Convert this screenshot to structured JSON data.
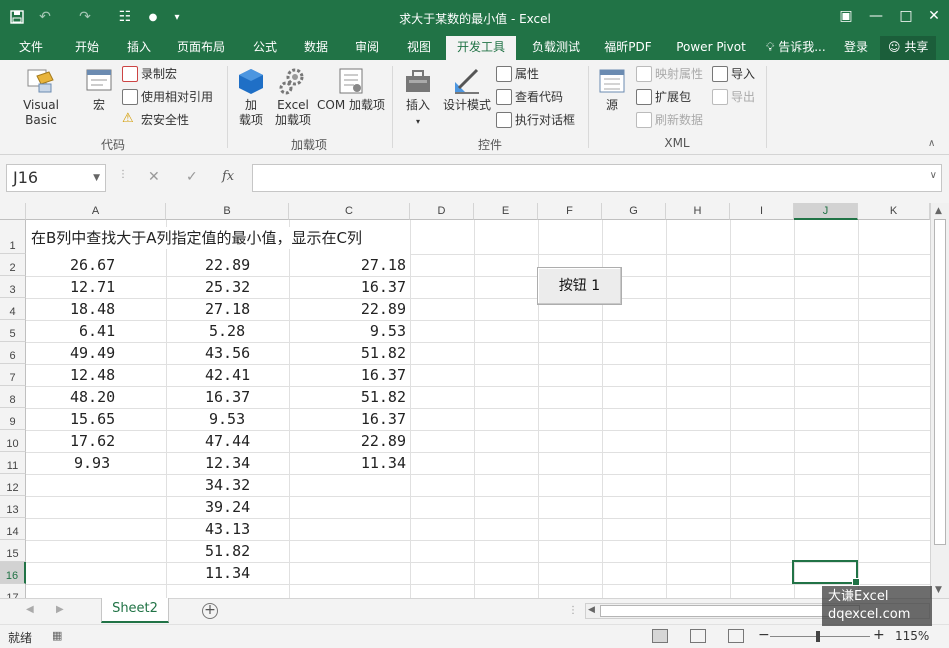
{
  "window": {
    "title": "求大于某数的最小值 - Excel"
  },
  "quick_access": {
    "icons": [
      "save-icon",
      "undo-icon",
      "redo-icon",
      "custom-icon",
      "touch-mode-icon",
      "customize-qat-icon"
    ]
  },
  "tabs": [
    "文件",
    "开始",
    "插入",
    "页面布局",
    "公式",
    "数据",
    "审阅",
    "视图",
    "开发工具",
    "负载测试",
    "福昕PDF",
    "Power Pivot"
  ],
  "active_tab": "开发工具",
  "tab_right": {
    "tell_me": "告诉我...",
    "signin": "登录",
    "share": "共享"
  },
  "ribbon": {
    "code": {
      "visual_basic": "Visual Basic",
      "macros": "宏",
      "record_macro": "录制宏",
      "relative_refs": "使用相对引用",
      "macro_security": "宏安全性",
      "group_label": "代码"
    },
    "addins": {
      "addins_line1": "加",
      "addins_line2": "载项",
      "excel_addins_line1": "Excel",
      "excel_addins_line2": "加载项",
      "com_addins": "COM 加载项",
      "group_label": "加载项"
    },
    "controls": {
      "insert": "插入",
      "design_mode": "设计模式",
      "properties": "属性",
      "view_code": "查看代码",
      "run_dialog": "执行对话框",
      "group_label": "控件"
    },
    "xml": {
      "source": "源",
      "map_properties": "映射属性",
      "expansion_packs": "扩展包",
      "refresh_data": "刷新数据",
      "import": "导入",
      "export": "导出",
      "group_label": "XML"
    }
  },
  "formula_bar": {
    "name_box": "J16",
    "fx": "fx",
    "formula": ""
  },
  "sheet": {
    "columns": [
      "A",
      "B",
      "C",
      "D",
      "E",
      "F",
      "G",
      "H",
      "I",
      "J",
      "K"
    ],
    "rows": [
      "1",
      "2",
      "3",
      "4",
      "5",
      "6",
      "7",
      "8",
      "9",
      "10",
      "11",
      "12",
      "13",
      "14",
      "15",
      "16",
      "17"
    ],
    "selected_cell": "J16",
    "title_text": "在B列中查找大于A列指定值的最小值，显示在C列",
    "col_a": [
      "26.67",
      "12.71",
      "18.48",
      "6.41",
      "49.49",
      "12.48",
      "48.20",
      "15.65",
      "17.62",
      "9.93"
    ],
    "col_b": [
      "22.89",
      "25.32",
      "27.18",
      "5.28",
      "43.56",
      "42.41",
      "16.37",
      "9.53",
      "47.44",
      "12.34",
      "34.32",
      "39.24",
      "43.13",
      "51.82",
      "11.34"
    ],
    "col_c": [
      "27.18",
      "16.37",
      "22.89",
      "9.53",
      "51.82",
      "16.37",
      "51.82",
      "16.37",
      "22.89",
      "11.34"
    ],
    "form_button": "按钮 1"
  },
  "sheet_tabs": [
    "Sheet2"
  ],
  "status": {
    "mode": "就绪",
    "zoom": "115%"
  },
  "watermark": {
    "line1": "大谦Excel",
    "line2": "dqexcel.com"
  }
}
